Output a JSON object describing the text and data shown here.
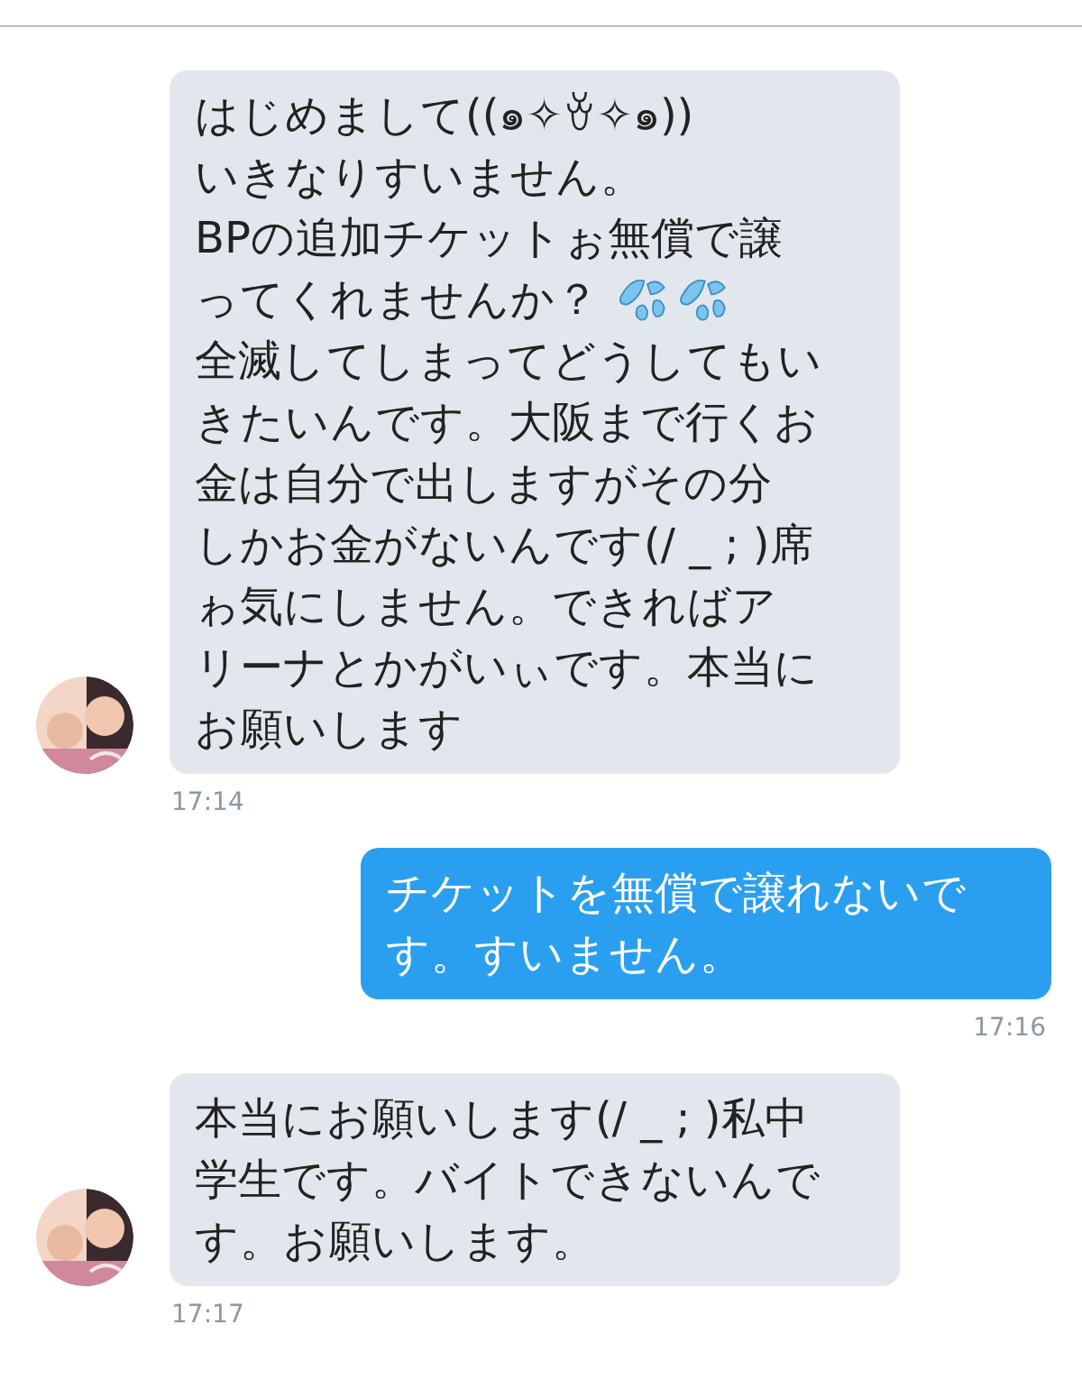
{
  "messages": [
    {
      "kind": "received",
      "lines": [
        {
          "kind": "plain",
          "text": "はじめまして((๑✧ꈊ✧๑))"
        },
        {
          "kind": "plain",
          "text": "いきなりすいません。"
        },
        {
          "kind": "plain",
          "text": "BPの追加チケットぉ無償で譲"
        },
        {
          "kind": "sweat",
          "text": "ってくれませんか？"
        },
        {
          "kind": "plain",
          "text": "全滅してしまってどうしてもい"
        },
        {
          "kind": "plain",
          "text": "きたいんです。大阪まで行くお"
        },
        {
          "kind": "plain",
          "text": "金は自分で出しますがその分"
        },
        {
          "kind": "plain",
          "text": "しかお金がないんです(/ _ ; )席"
        },
        {
          "kind": "plain",
          "text": "ゎ気にしません。できればア"
        },
        {
          "kind": "plain",
          "text": "リーナとかがいぃです。本当に"
        },
        {
          "kind": "plain",
          "text": "お願いします"
        }
      ],
      "time": "17:14"
    },
    {
      "kind": "sent",
      "lines": [
        {
          "kind": "plain",
          "text": "チケットを無償で譲れないで"
        },
        {
          "kind": "plain",
          "text": "す。すいません。"
        }
      ],
      "time": "17:16"
    },
    {
      "kind": "received",
      "lines": [
        {
          "kind": "plain",
          "text": "本当にお願いします(/ _ ; )私中"
        },
        {
          "kind": "plain",
          "text": "学生です。バイトできないんで"
        },
        {
          "kind": "plain",
          "text": "す。お願いします。"
        }
      ],
      "time": "17:17"
    }
  ]
}
